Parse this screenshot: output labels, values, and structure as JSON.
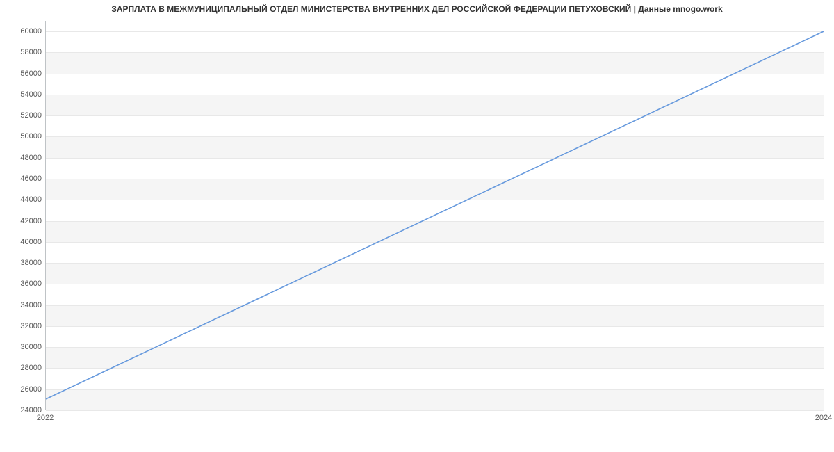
{
  "chart_data": {
    "type": "line",
    "title": "ЗАРПЛАТА В МЕЖМУНИЦИПАЛЬНЫЙ ОТДЕЛ МИНИСТЕРСТВА ВНУТРЕННИХ ДЕЛ РОССИЙСКОЙ ФЕДЕРАЦИИ ПЕТУХОВСКИЙ | Данные mnogo.work",
    "xlabel": "",
    "ylabel": "",
    "x_ticks": [
      "2022",
      "2024"
    ],
    "y_ticks": [
      24000,
      26000,
      28000,
      30000,
      32000,
      34000,
      36000,
      38000,
      40000,
      42000,
      44000,
      46000,
      48000,
      50000,
      52000,
      54000,
      56000,
      58000,
      60000
    ],
    "ylim": [
      24000,
      61000
    ],
    "xlim": [
      2022,
      2024
    ],
    "series": [
      {
        "name": "salary",
        "x": [
          2022,
          2024
        ],
        "values": [
          25000,
          60000
        ]
      }
    ],
    "colors": {
      "line": "#6699dd",
      "band": "#f5f5f5"
    }
  }
}
